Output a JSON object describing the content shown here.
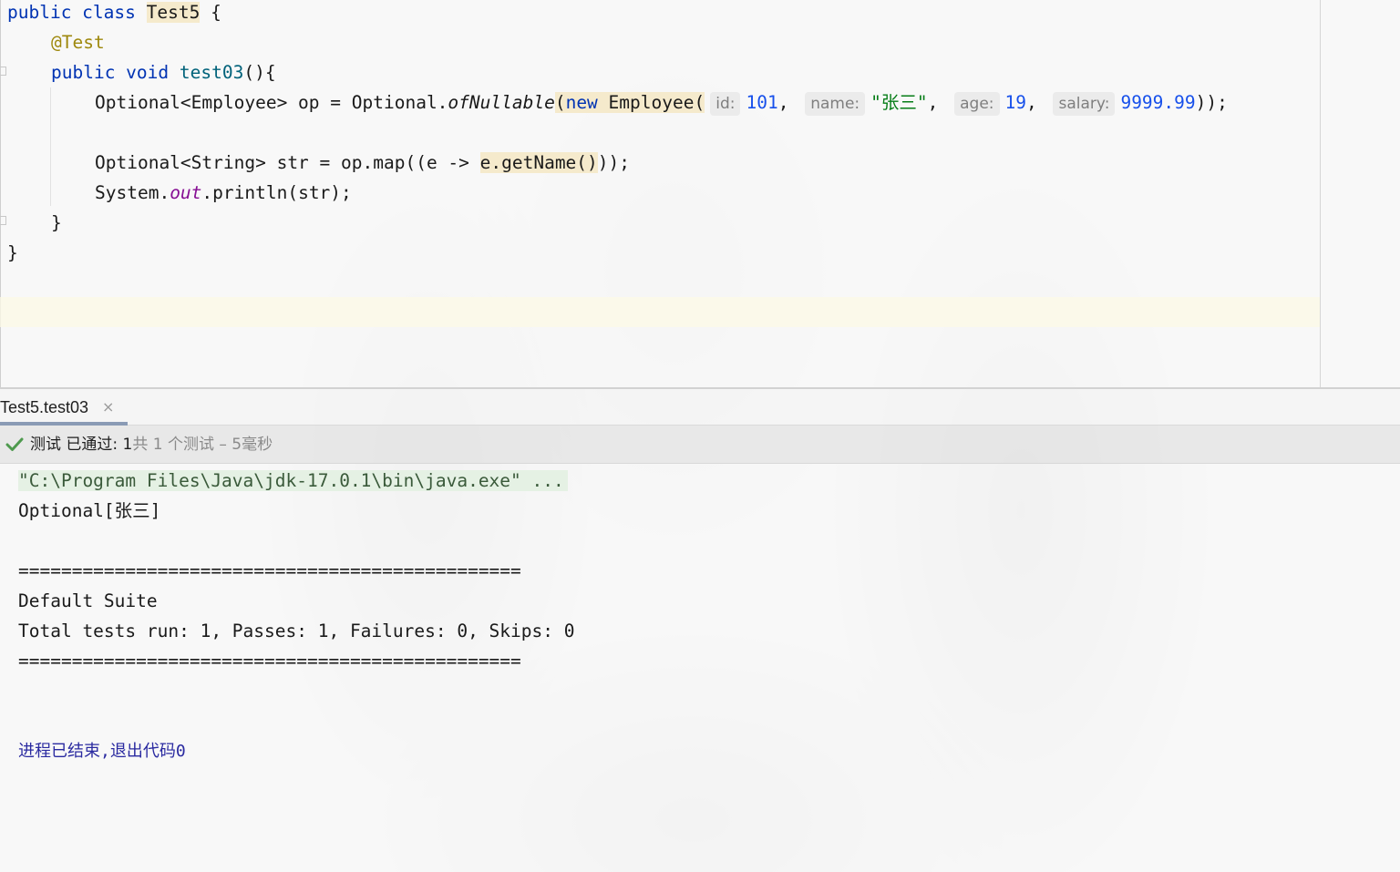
{
  "editor": {
    "lines": {
      "l1": {
        "kw": "public class ",
        "cls": "Test5",
        "rest": " {"
      },
      "l2": {
        "annotation": "@Test"
      },
      "l3": {
        "kw": "public void ",
        "method": "test03",
        "rest": "(){"
      },
      "l4": {
        "prefix": "Optional<Employee> op = Optional.",
        "call": "ofNullable",
        "open": "(",
        "kw_new": "new",
        "ctor": " Employee(",
        "hint_id": "id:",
        "val_id": "101",
        "hint_name": "name:",
        "val_name": "\"张三\"",
        "hint_age": "age:",
        "val_age": "19",
        "hint_salary": "salary:",
        "val_salary": "9999.99",
        "close": "));"
      },
      "l5": {
        "prefix": "Optional<String> str = op.map((e -> ",
        "hl": "e.getName()",
        "suffix": "));"
      },
      "l6": {
        "prefix": "System.",
        "field": "out",
        "suffix": ".println(str);"
      },
      "l7": {
        "text": "}"
      },
      "l8": {
        "text": "}"
      }
    }
  },
  "run_panel": {
    "tab_label": "Test5.test03",
    "tab_close": "×",
    "status": {
      "passed_label": "测试 已通过: ",
      "passed_count": "1",
      "detail": "共 1 个测试 – 5毫秒"
    },
    "console": {
      "cmd": "\"C:\\Program Files\\Java\\jdk-17.0.1\\bin\\java.exe\" ...",
      "output": "Optional[张三]",
      "sep1": "===============================================",
      "suite": "Default Suite",
      "summary": "Total tests run: 1, Passes: 1, Failures: 0, Skips: 0",
      "sep2": "===============================================",
      "exit": "进程已结束,退出代码0"
    }
  },
  "colors": {
    "keyword": "#0033b3",
    "annotation": "#9e880d",
    "string": "#067d17",
    "number": "#1750eb",
    "pass_icon": "#4e9a4e"
  }
}
